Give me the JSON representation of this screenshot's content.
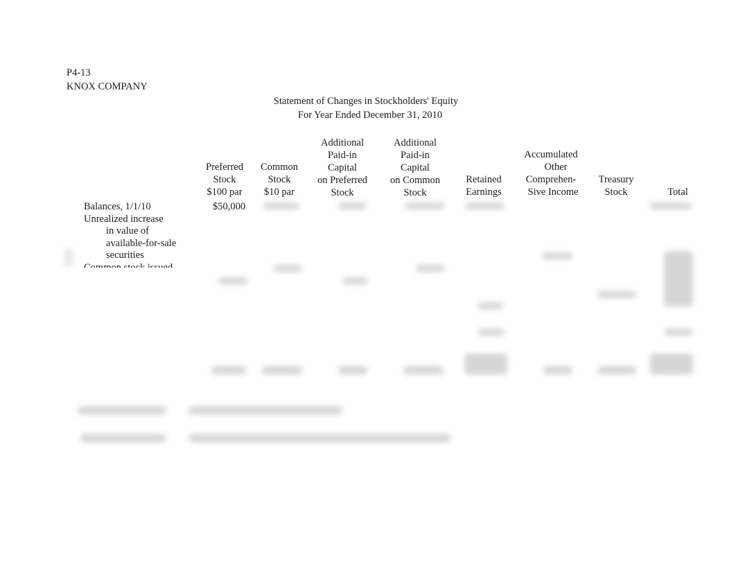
{
  "problem_id": "P4-13",
  "company": "KNOX COMPANY",
  "statement_title": "Statement of Changes in Stockholders' Equity",
  "statement_period": "For Year Ended December 31, 2010",
  "columns": [
    {
      "lines": [
        "Preferred",
        "Stock",
        "$100 par"
      ]
    },
    {
      "lines": [
        "Common",
        "Stock",
        "$10 par"
      ]
    },
    {
      "lines": [
        "Additional",
        "Paid-in",
        "Capital",
        "on Preferred",
        "Stock"
      ]
    },
    {
      "lines": [
        "Additional",
        "Paid-in",
        "Capital",
        "on Common",
        "Stock"
      ]
    },
    {
      "lines": [
        "Retained",
        "Earnings"
      ]
    },
    {
      "lines": [
        "Accumulated",
        "Other",
        "Comprehen-",
        "Sive Income"
      ]
    },
    {
      "lines": [
        "Treasury",
        "Stock"
      ]
    },
    {
      "lines": [
        "Total"
      ]
    }
  ],
  "row_labels": {
    "balances": "Balances, 1/1/10",
    "unrealized_1": "Unrealized increase",
    "unrealized_2": "in value of",
    "unrealized_3": "available-for-sale",
    "unrealized_4": "securities",
    "common_issued": "Common stock issued"
  },
  "visible_values": {
    "preferred_beginning": "$50,000"
  }
}
